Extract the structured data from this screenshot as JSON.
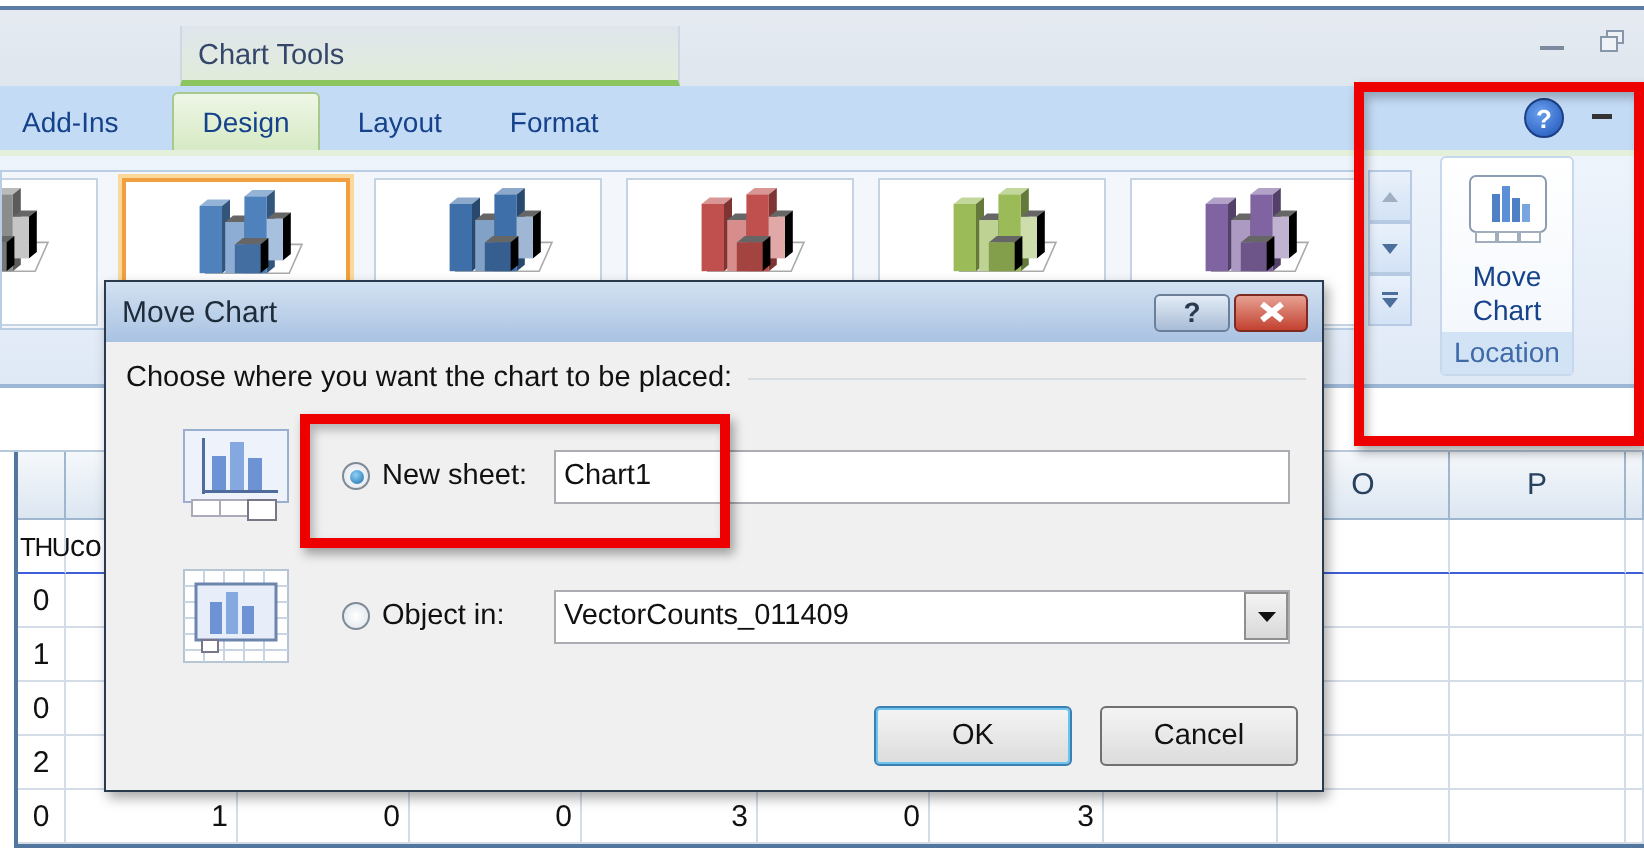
{
  "ribbon": {
    "contextual_label": "Chart Tools",
    "tabs": [
      {
        "label": "Add-Ins",
        "selected": false
      },
      {
        "label": "Design",
        "selected": true
      },
      {
        "label": "Layout",
        "selected": false
      },
      {
        "label": "Format",
        "selected": false
      }
    ],
    "help_button": "?",
    "chart_styles": [
      {
        "color": "#8c8c8c",
        "selected": false
      },
      {
        "color": "#4f81bd",
        "selected": true
      },
      {
        "color": "#3f6fa8",
        "selected": false
      },
      {
        "color": "#c0504d",
        "selected": false
      },
      {
        "color": "#9bbb59",
        "selected": false
      },
      {
        "color": "#8064a2",
        "selected": false
      }
    ],
    "location_group": {
      "button": "Move Chart",
      "label": "Location"
    }
  },
  "sheet": {
    "column_headers": [
      {
        "label": "O"
      },
      {
        "label": "P"
      }
    ],
    "rows": [
      {
        "kind": "header",
        "cells": [
          "THU",
          "co"
        ]
      },
      {
        "kind": "data",
        "cells": [
          "0"
        ]
      },
      {
        "kind": "data",
        "cells": [
          "1"
        ]
      },
      {
        "kind": "data",
        "cells": [
          "0"
        ]
      },
      {
        "kind": "data",
        "cells": [
          "2"
        ]
      },
      {
        "kind": "data",
        "cells": [
          "0",
          "1",
          "0",
          "0",
          "3",
          "0",
          "3"
        ]
      }
    ]
  },
  "dialog": {
    "title": "Move Chart",
    "help_button": "?",
    "prompt": "Choose where you want the chart to be placed:",
    "options": [
      {
        "kind": "text",
        "label": "New sheet:",
        "selected": true,
        "value": "Chart1"
      },
      {
        "kind": "combo",
        "label": "Object in:",
        "selected": false,
        "value": "VectorCounts_011409"
      }
    ],
    "buttons": [
      {
        "label": "OK",
        "default": true
      },
      {
        "label": "Cancel",
        "default": false
      }
    ]
  }
}
